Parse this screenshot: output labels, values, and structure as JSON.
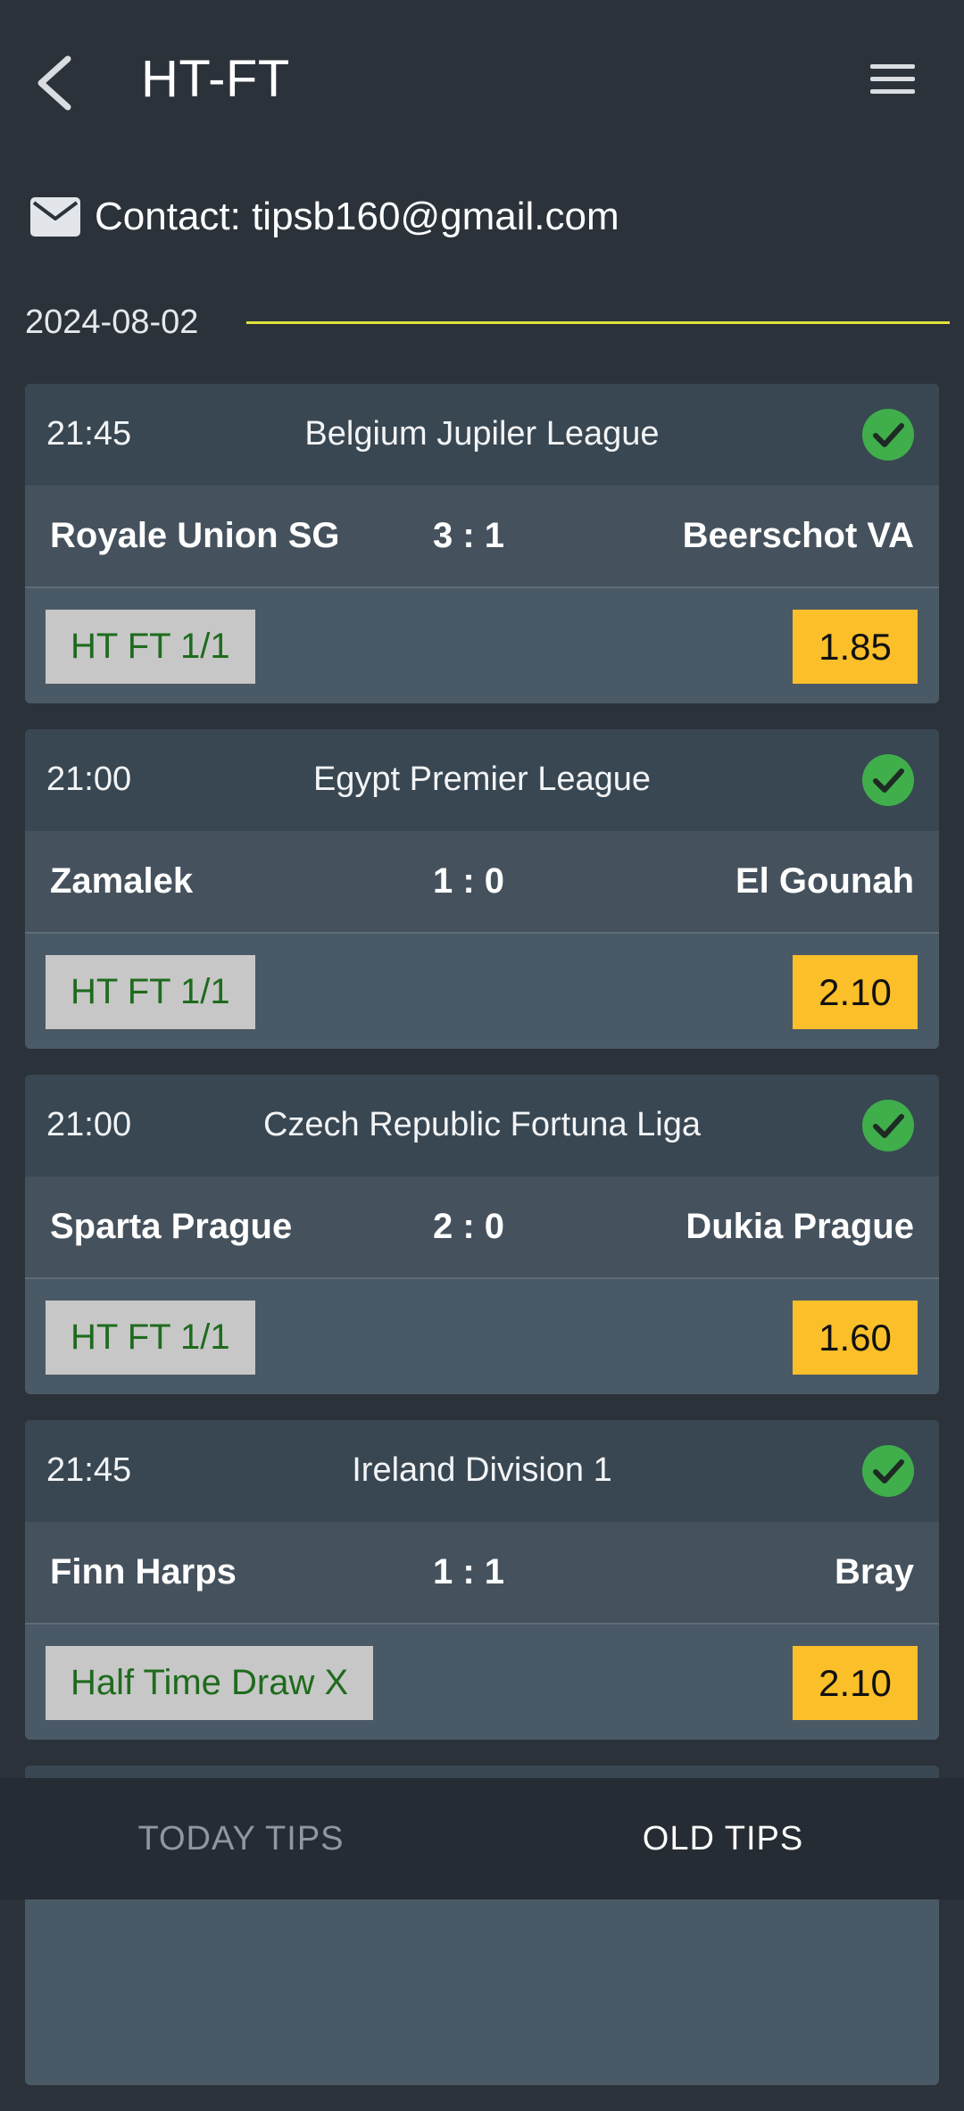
{
  "header": {
    "title": "HT-FT",
    "back_icon": "chevron-left-icon",
    "menu_icon": "hamburger-menu-icon"
  },
  "contact": {
    "icon": "mail-icon",
    "text": "Contact: tipsb160@gmail.com"
  },
  "date": "2024-08-02",
  "colors": {
    "background": "#2b323a",
    "card_head": "#394752",
    "card_body": "#4a5966",
    "odds": "#fbbf2a",
    "tip_text": "#1e6b1d",
    "tip_bg": "#c7c7c7",
    "check": "#3fae4b",
    "date_line": "#e1e33c"
  },
  "matches": [
    {
      "time": "21:45",
      "league": "Belgium Jupiler League",
      "home": "Royale Union SG",
      "score": "3 : 1",
      "away": "Beerschot VA",
      "tip": "HT FT 1/1",
      "odds": "1.85",
      "status_icon": "check-circle-icon"
    },
    {
      "time": "21:00",
      "league": "Egypt Premier League",
      "home": "Zamalek",
      "score": "1 : 0",
      "away": "El Gounah",
      "tip": "HT FT 1/1",
      "odds": "2.10",
      "status_icon": "check-circle-icon"
    },
    {
      "time": "21:00",
      "league": "Czech Republic Fortuna Liga",
      "home": "Sparta Prague",
      "score": "2 : 0",
      "away": "Dukia Prague",
      "tip": "HT FT 1/1",
      "odds": "1.60",
      "status_icon": "check-circle-icon"
    },
    {
      "time": "21:45",
      "league": "Ireland Division 1",
      "home": "Finn Harps",
      "score": "1 : 1",
      "away": "Bray",
      "tip": "Half Time Draw X",
      "odds": "2.10",
      "status_icon": "check-circle-icon"
    }
  ],
  "bottom_nav": {
    "today": "TODAY TIPS",
    "old": "OLD TIPS"
  }
}
